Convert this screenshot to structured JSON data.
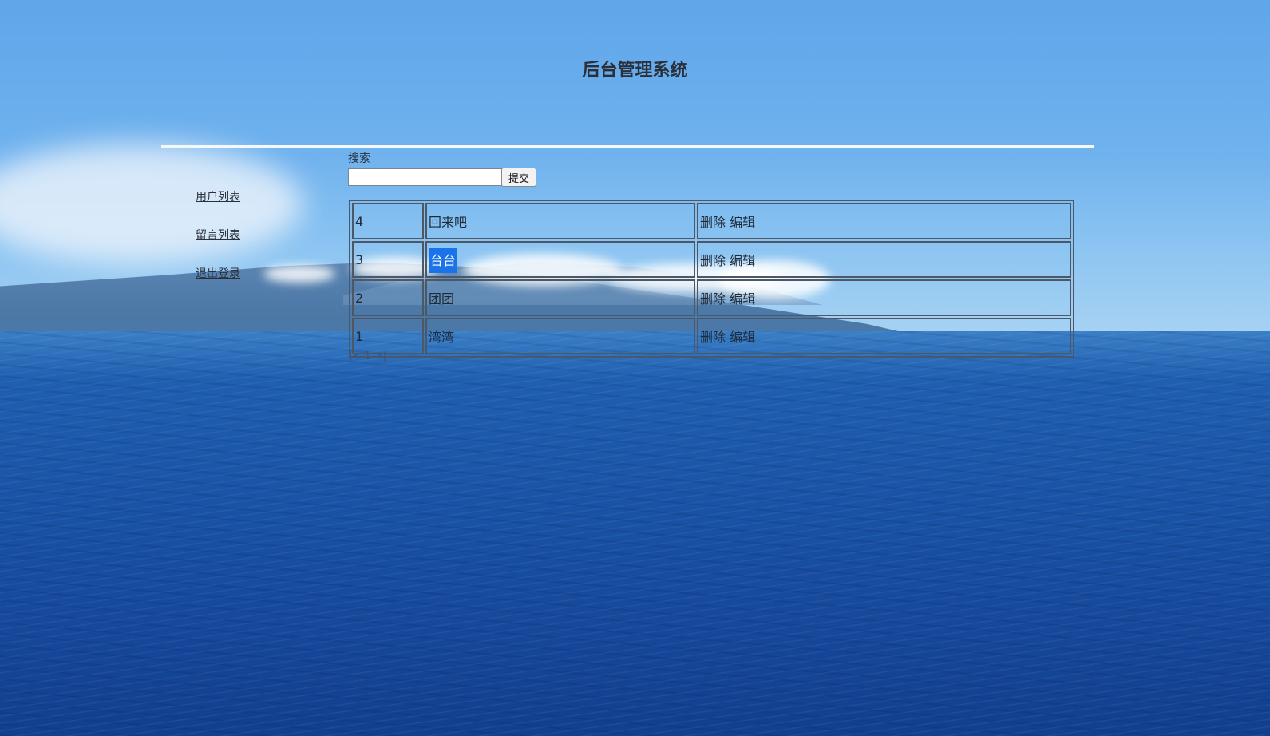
{
  "header": {
    "title": "后台管理系统"
  },
  "sidebar": {
    "items": [
      {
        "label": "用户列表"
      },
      {
        "label": "留言列表"
      },
      {
        "label": "退出登录"
      }
    ]
  },
  "search": {
    "label": "搜索",
    "value": "",
    "placeholder": "",
    "submit_label": "提交"
  },
  "table": {
    "rows": [
      {
        "id": "4",
        "name": "回来吧",
        "delete_label": "删除",
        "edit_label": "编辑"
      },
      {
        "id": "3",
        "name": "台台",
        "delete_label": "删除",
        "edit_label": "编辑",
        "selected": true
      },
      {
        "id": "2",
        "name": "团团",
        "delete_label": "删除",
        "edit_label": "编辑"
      },
      {
        "id": "1",
        "name": "湾湾",
        "delete_label": "删除",
        "edit_label": "编辑"
      }
    ]
  },
  "pagination": {
    "first": "|<",
    "current": "1",
    "last": ">|"
  },
  "colors": {
    "selection": "#1a73e8",
    "text": "#2a2f38",
    "border": "#4d5866"
  }
}
